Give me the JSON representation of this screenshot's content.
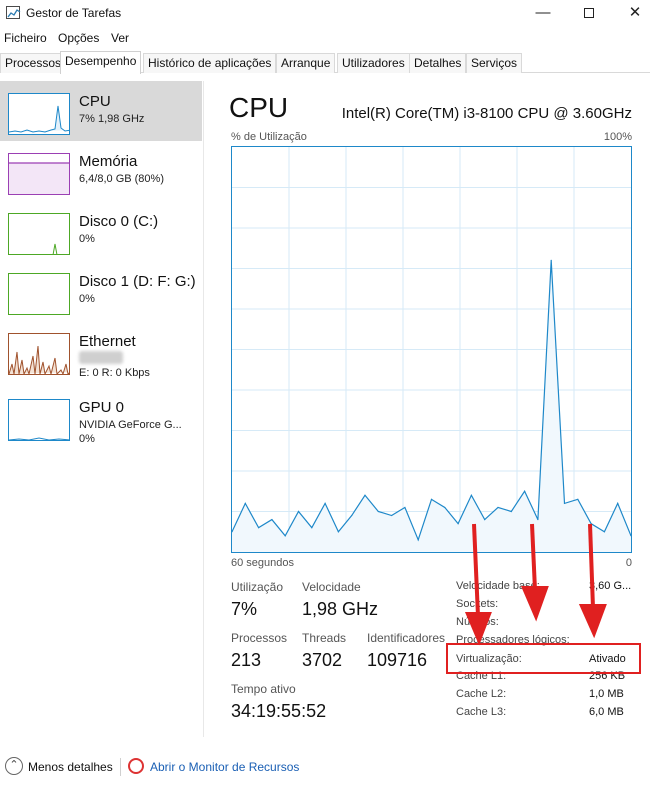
{
  "window": {
    "title": "Gestor de Tarefas",
    "minimize_glyph": "—",
    "close_glyph": "✕"
  },
  "menu": [
    "Ficheiro",
    "Opções",
    "Ver"
  ],
  "tabs": [
    "Processos",
    "Desempenho",
    "Histórico de aplicações",
    "Arranque",
    "Utilizadores",
    "Detalhes",
    "Serviços"
  ],
  "active_tab": "Desempenho",
  "sidebar": {
    "items": [
      {
        "name": "CPU",
        "line1": "7% 1,98 GHz",
        "line2": "",
        "color": "#1e88c9",
        "icon": "cpu-graph-icon"
      },
      {
        "name": "Memória",
        "line1": "6,4/8,0 GB (80%)",
        "line2": "",
        "color": "#9b3fb4",
        "icon": "memory-graph-icon"
      },
      {
        "name": "Disco 0 (C:)",
        "line1": "0%",
        "line2": "",
        "color": "#4da825",
        "icon": "disk-graph-icon"
      },
      {
        "name": "Disco 1 (D: F: G:)",
        "line1": "0%",
        "line2": "",
        "color": "#4da825",
        "icon": "disk-graph-icon"
      },
      {
        "name": "Ethernet",
        "line1": "",
        "line2": "E: 0 R: 0 Kbps",
        "color": "#a0522d",
        "icon": "ethernet-graph-icon"
      },
      {
        "name": "GPU 0",
        "line1": "NVIDIA GeForce G...",
        "line2": "0%",
        "color": "#1e88c9",
        "icon": "gpu-graph-icon"
      }
    ]
  },
  "main": {
    "title": "CPU",
    "model": "Intel(R) Core(TM) i3-8100 CPU @ 3.60GHz",
    "axis_top_left": "% de Utilização",
    "axis_top_right": "100%",
    "axis_bottom_left": "60 segundos",
    "axis_bottom_right": "0",
    "stats": {
      "utilizacao_label": "Utilização",
      "utilizacao_value": "7%",
      "velocidade_label": "Velocidade",
      "velocidade_value": "1,98 GHz",
      "processos_label": "Processos",
      "processos_value": "213",
      "threads_label": "Threads",
      "threads_value": "3702",
      "identificadores_label": "Identificadores",
      "identificadores_value": "109716",
      "tempo_label": "Tempo ativo",
      "tempo_value": "34:19:55:52"
    },
    "specs": [
      {
        "label": "Velocidade base:",
        "value": "3,60 G..."
      },
      {
        "label": "Sockets:",
        "value": ""
      },
      {
        "label": "Núcleos:",
        "value": ""
      },
      {
        "label": "Processadores lógicos:",
        "value": ""
      },
      {
        "label": "Virtualização:",
        "value": "Ativado"
      },
      {
        "label": "Cache L1:",
        "value": "256 KB"
      },
      {
        "label": "Cache L2:",
        "value": "1,0 MB"
      },
      {
        "label": "Cache L3:",
        "value": "6,0 MB"
      }
    ]
  },
  "footer": {
    "less_details": "Menos detalhes",
    "resource_monitor": "Abrir o Monitor de Recursos"
  },
  "chart_data": {
    "type": "area",
    "xlabel": "60 segundos",
    "ylabel": "% de Utilização",
    "ylim": [
      0,
      100
    ],
    "x": [
      60,
      58,
      56,
      54,
      52,
      50,
      48,
      46,
      44,
      42,
      40,
      38,
      36,
      34,
      32,
      30,
      28,
      26,
      24,
      22,
      20,
      18,
      16,
      14,
      12,
      10,
      8,
      6,
      4,
      2,
      0
    ],
    "values": [
      5,
      12,
      6,
      8,
      4,
      10,
      6,
      12,
      5,
      9,
      14,
      10,
      9,
      11,
      3,
      13,
      11,
      7,
      14,
      8,
      11,
      10,
      15,
      8,
      72,
      12,
      13,
      7,
      5,
      12,
      4
    ],
    "grid": true,
    "color": "#1e88c9"
  }
}
